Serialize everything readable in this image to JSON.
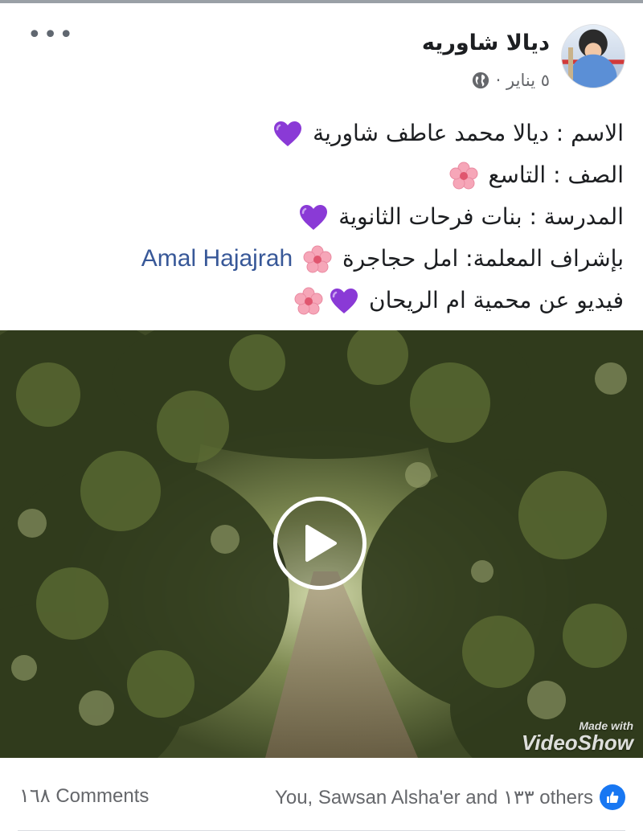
{
  "post": {
    "author": "ديالا شاوريه",
    "date": "٥ يناير ·",
    "lines": [
      {
        "text": "الاسم : ديالا محمد عاطف شاورية",
        "emoji": "purple-heart"
      },
      {
        "text": "الصف : التاسع",
        "emoji": "cherry-blossom"
      },
      {
        "text": "المدرسة : بنات فرحات الثانوية",
        "emoji": "purple-heart"
      },
      {
        "text": "بإشراف المعلمة: امل حجاجرة",
        "emoji": "cherry-blossom",
        "mention": "Amal Hajajrah"
      },
      {
        "text": "فيديو عن محمية ام الريحان",
        "emoji": "purple-heart",
        "emoji2": "cherry-blossom"
      }
    ]
  },
  "video": {
    "watermark_small": "Made with",
    "watermark_big": "VideoShow"
  },
  "footer": {
    "reactions_text": "You, Sawsan Alsha'er and ١٣٣ others",
    "comments_text": "١٦٨ Comments"
  },
  "colors": {
    "link": "#385898",
    "like": "#1877f2",
    "purple_heart": "#8a3ad6",
    "blossom": "#f6a6b8"
  },
  "icons": [
    "more-options-icon",
    "globe-icon",
    "purple-heart-icon",
    "cherry-blossom-icon",
    "play-icon",
    "like-icon"
  ]
}
